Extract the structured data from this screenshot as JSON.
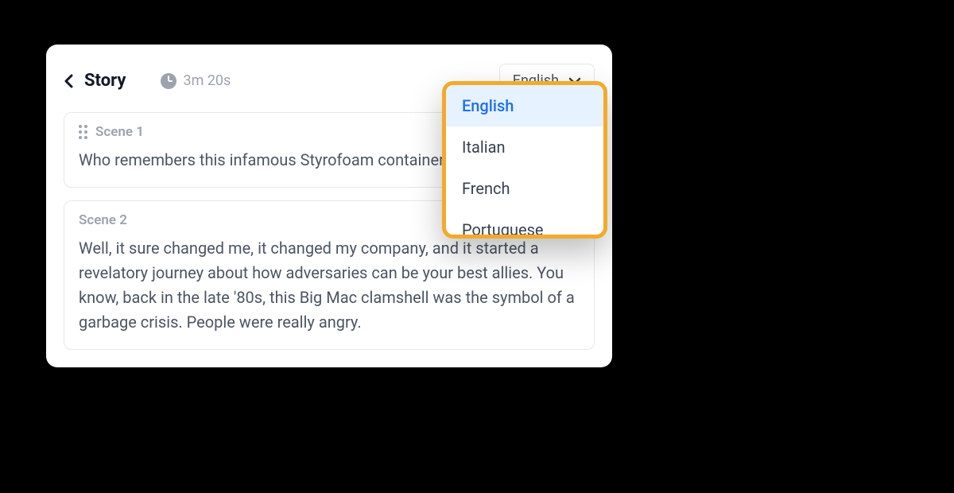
{
  "header": {
    "title": "Story",
    "duration": "3m 20s"
  },
  "language_selector": {
    "selected": "English",
    "options": [
      "English",
      "Italian",
      "French",
      "Portuguese"
    ]
  },
  "scenes": [
    {
      "title": "Scene 1",
      "text": "Who remembers this infamous Styrofoam container?",
      "draggable": true
    },
    {
      "title": "Scene 2",
      "text": "Well, it sure changed me, it changed my company, and it started a revelatory journey about how adversaries can be your best allies.   You know, back in the late '80s, this Big Mac clamshell was the symbol of a garbage crisis. People were really angry.",
      "draggable": false
    }
  ]
}
